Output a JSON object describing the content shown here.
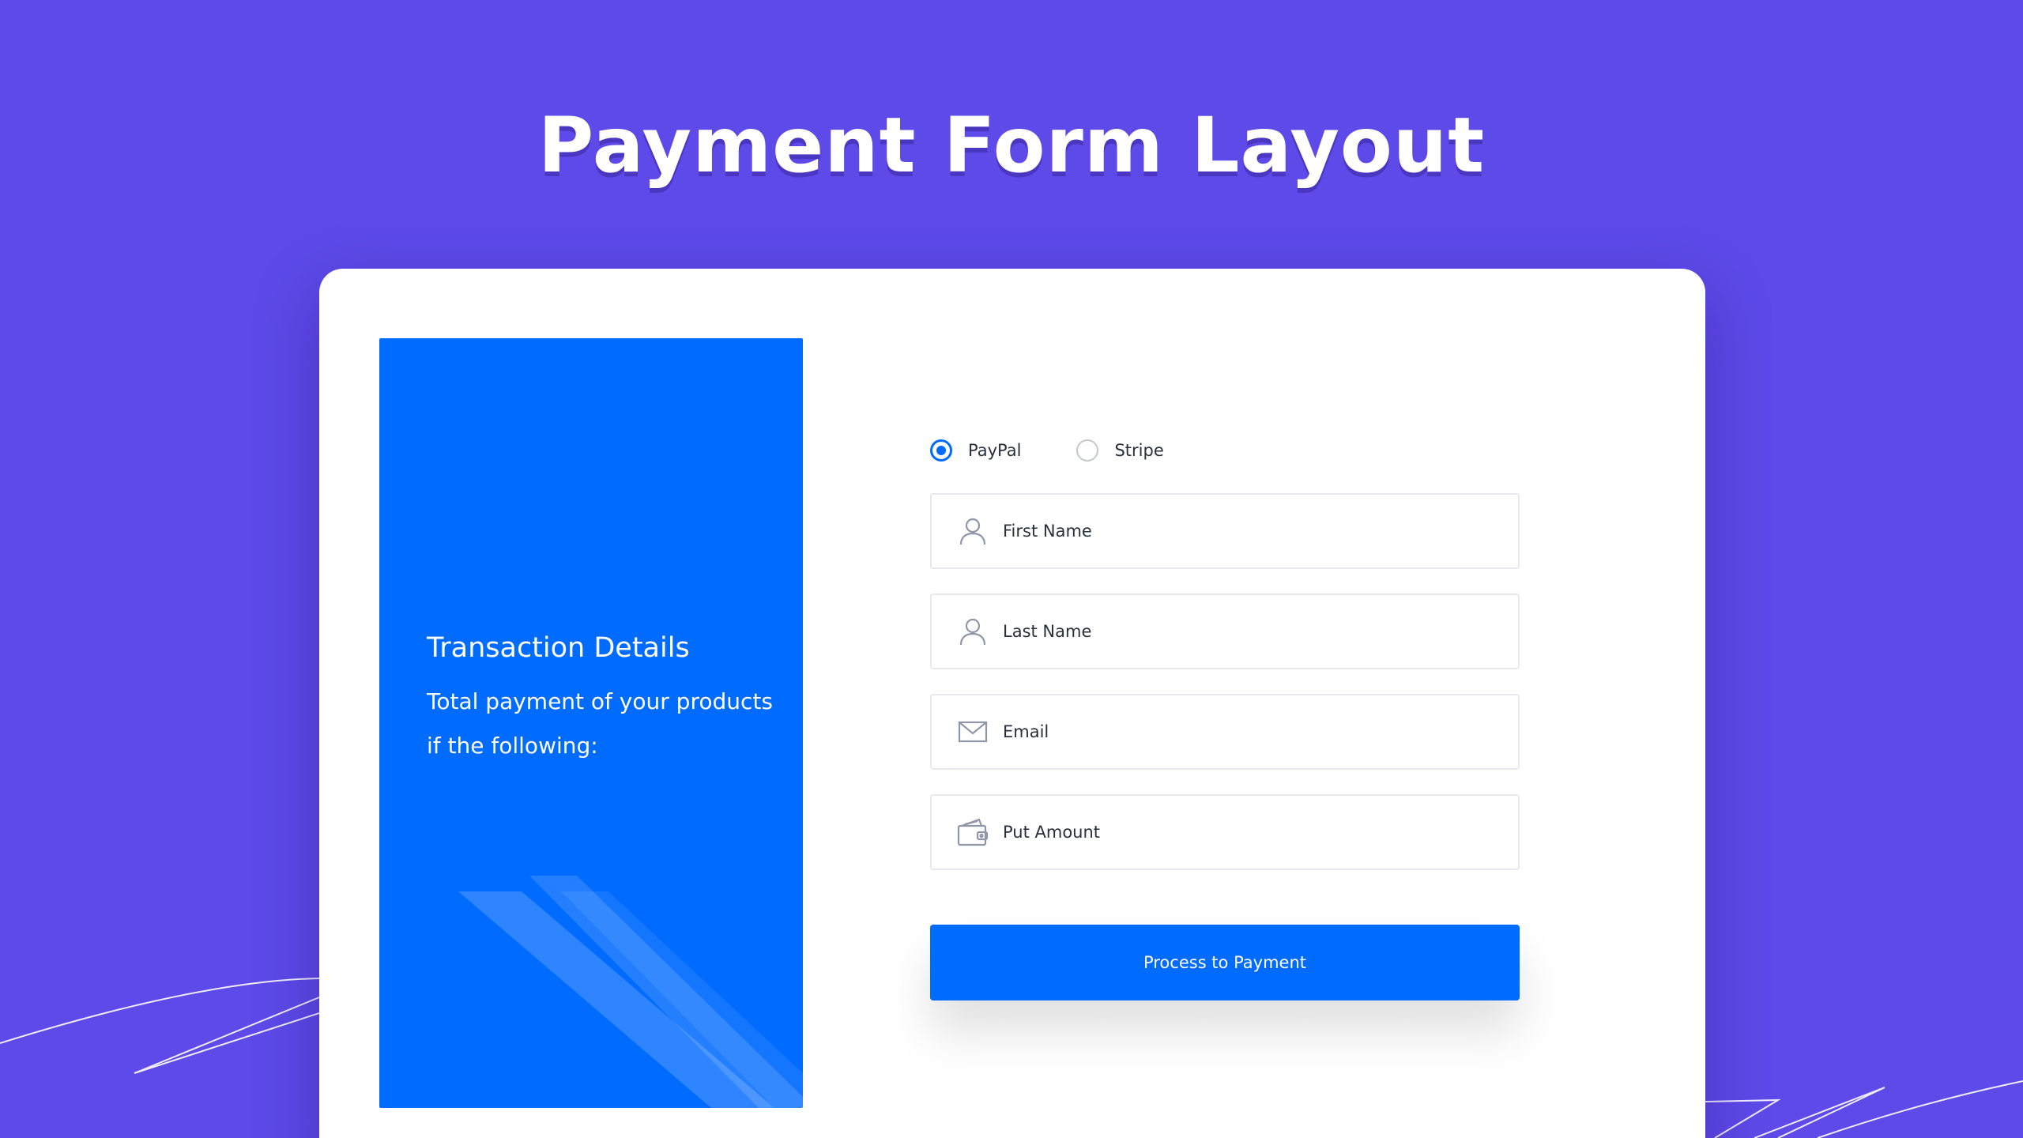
{
  "page": {
    "title": "Payment Form Layout"
  },
  "transaction": {
    "title": "Transaction Details",
    "description": "Total payment of your products if the following:"
  },
  "payment_methods": {
    "selected": "PayPal",
    "options": [
      {
        "label": "PayPal",
        "checked": true
      },
      {
        "label": "Stripe",
        "checked": false
      }
    ]
  },
  "form": {
    "fields": [
      {
        "placeholder": "First Name",
        "value": "",
        "icon": "user-icon"
      },
      {
        "placeholder": "Last Name",
        "value": "",
        "icon": "user-icon"
      },
      {
        "placeholder": "Email",
        "value": "",
        "icon": "envelope-icon"
      },
      {
        "placeholder": "Put Amount",
        "value": "",
        "icon": "wallet-icon"
      }
    ],
    "submit_label": "Process to Payment"
  },
  "colors": {
    "background": "#5d4ae8",
    "accent": "#006bff",
    "card": "#ffffff",
    "field_border": "#e7e9ee",
    "text": "#2a2f3c"
  }
}
